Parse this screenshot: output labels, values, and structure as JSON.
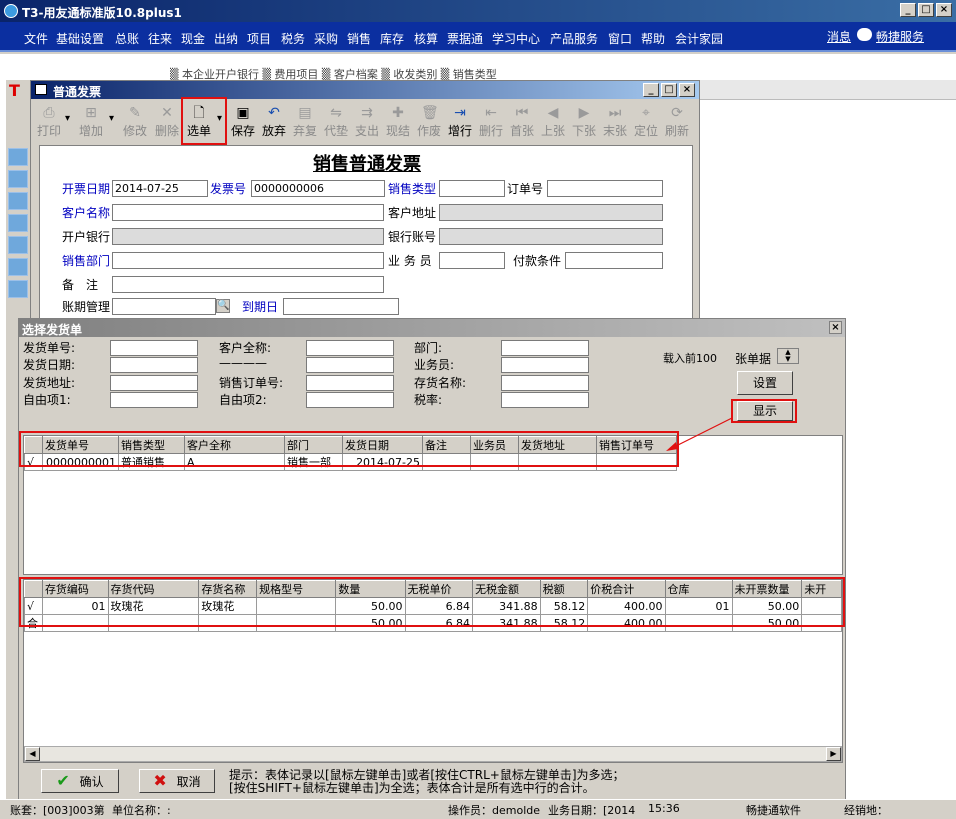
{
  "app": {
    "title": "T3-用友通标准版10.8plus1"
  },
  "menu": [
    "文件",
    "基础设置",
    "总账",
    "往来",
    "现金",
    "出纳",
    "项目",
    "税务",
    "采购",
    "销售",
    "库存",
    "核算",
    "票据通",
    "学习中心",
    "产品服务",
    "窗口",
    "帮助",
    "会计家园"
  ],
  "menu_right": {
    "message": "消息",
    "service": "畅捷服务"
  },
  "bg_tabs": "▒ 本企业开户银行 ▒ 费用项目 ▒ 客户档案 ▒ 收发类别 ▒ 销售类型",
  "invoice_window": {
    "title": "普通发票",
    "toolbar": [
      {
        "label": "打印",
        "icon": "print-icon",
        "enabled": false
      },
      {
        "label": "增加",
        "icon": "add-icon",
        "enabled": false
      },
      {
        "label": "修改",
        "icon": "edit-icon",
        "enabled": false
      },
      {
        "label": "删除",
        "icon": "delete-icon",
        "enabled": false
      },
      {
        "label": "选单",
        "icon": "select-doc-icon",
        "enabled": true
      },
      {
        "label": "保存",
        "icon": "save-icon",
        "enabled": true
      },
      {
        "label": "放弃",
        "icon": "undo-icon",
        "enabled": true
      },
      {
        "label": "弃复",
        "icon": "restore-icon",
        "enabled": false
      },
      {
        "label": "代垫",
        "icon": "advance-icon",
        "enabled": false
      },
      {
        "label": "支出",
        "icon": "expense-icon",
        "enabled": false
      },
      {
        "label": "现结",
        "icon": "cash-settle-icon",
        "enabled": false
      },
      {
        "label": "作废",
        "icon": "void-icon",
        "enabled": false
      },
      {
        "label": "增行",
        "icon": "add-row-icon",
        "enabled": true
      },
      {
        "label": "删行",
        "icon": "delete-row-icon",
        "enabled": false
      },
      {
        "label": "首张",
        "icon": "first-icon",
        "enabled": false
      },
      {
        "label": "上张",
        "icon": "prev-icon",
        "enabled": false
      },
      {
        "label": "下张",
        "icon": "next-icon",
        "enabled": false
      },
      {
        "label": "末张",
        "icon": "last-icon",
        "enabled": false
      },
      {
        "label": "定位",
        "icon": "locate-icon",
        "enabled": false
      },
      {
        "label": "刷新",
        "icon": "refresh-icon",
        "enabled": false
      }
    ],
    "heading": "销售普通发票",
    "fields": {
      "invoice_date_label": "开票日期",
      "invoice_date": "2014-07-25",
      "invoice_no_label": "发票号",
      "invoice_no": "0000000006",
      "sales_type_label": "销售类型",
      "sales_type": "",
      "order_no_label": "订单号",
      "order_no": "",
      "customer_label": "客户名称",
      "customer": "",
      "customer_addr_label": "客户地址",
      "customer_addr": "",
      "bank_label": "开户银行",
      "bank": "",
      "account_label": "银行账号",
      "account": "",
      "dept_label": "销售部门",
      "dept": "",
      "salesman_label": "业 务 员",
      "salesman": "",
      "pay_terms_label": "付款条件",
      "pay_terms": "",
      "remark_label": "备　注",
      "remark": "",
      "period_label": "账期管理",
      "period": "",
      "due_label": "到期日",
      "due": ""
    }
  },
  "dialog": {
    "title": "选择发货单",
    "filters": [
      {
        "label": "发货单号:",
        "value": ""
      },
      {
        "label": "发货日期:",
        "value": ""
      },
      {
        "label": "发货地址:",
        "value": ""
      },
      {
        "label": "自由项1:",
        "value": ""
      },
      {
        "label": "客户全称:",
        "value": ""
      },
      {
        "label": "————",
        "value": ""
      },
      {
        "label": "销售订单号:",
        "value": ""
      },
      {
        "label": "自由项2:",
        "value": ""
      },
      {
        "label": "部门:",
        "value": ""
      },
      {
        "label": "业务员:",
        "value": ""
      },
      {
        "label": "存货名称:",
        "value": ""
      },
      {
        "label": "税率:",
        "value": ""
      }
    ],
    "load_label": "载入前100",
    "unit_label": "张单据",
    "settings_button": "设置",
    "show_button": "显示",
    "upper_grid": {
      "headers": [
        "",
        "发货单号",
        "销售类型",
        "客户全称",
        "部门",
        "发货日期",
        "备注",
        "业务员",
        "发货地址",
        "销售订单号"
      ],
      "rows": [
        [
          "√",
          "0000000001",
          "普通销售",
          "A",
          "销售一部",
          "2014-07-25",
          "",
          "",
          "",
          ""
        ]
      ]
    },
    "lower_grid": {
      "headers": [
        "",
        "存货编码",
        "存货代码",
        "存货名称",
        "规格型号",
        "数量",
        "无税单价",
        "无税金额",
        "税额",
        "价税合计",
        "仓库",
        "未开票数量",
        "未开"
      ],
      "rows": [
        [
          "√",
          "01",
          "玫瑰花",
          "玫瑰花",
          "",
          "50.00",
          "6.84",
          "341.88",
          "58.12",
          "400.00",
          "01",
          "50.00",
          ""
        ],
        [
          "合",
          "",
          "",
          "",
          "",
          "50.00",
          "6.84",
          "341.88",
          "58.12",
          "400.00",
          "",
          "50.00",
          ""
        ]
      ]
    },
    "confirm_button": "确认",
    "cancel_button": "取消",
    "hint_line1": "提示：表体记录以[鼠标左键单击]或者[按住CTRL+鼠标左键单击]为多选；",
    "hint_line2": "[按住SHIFT+鼠标左键单击]为全选；表体合计是所有选中行的合计。"
  },
  "status": {
    "account": "账套：[003]003第",
    "unit": "单位名称：:",
    "operator": "操作员：demolde",
    "biz_date": "业务日期：[2014",
    "time": "15:36",
    "vendor": "畅捷通软件",
    "dealer": "经销地："
  },
  "colors": {
    "title_bar": "#0a246a",
    "menu_bar": "#0b2fa0",
    "highlight_red": "#e01010",
    "link_blue": "#0000c0"
  }
}
